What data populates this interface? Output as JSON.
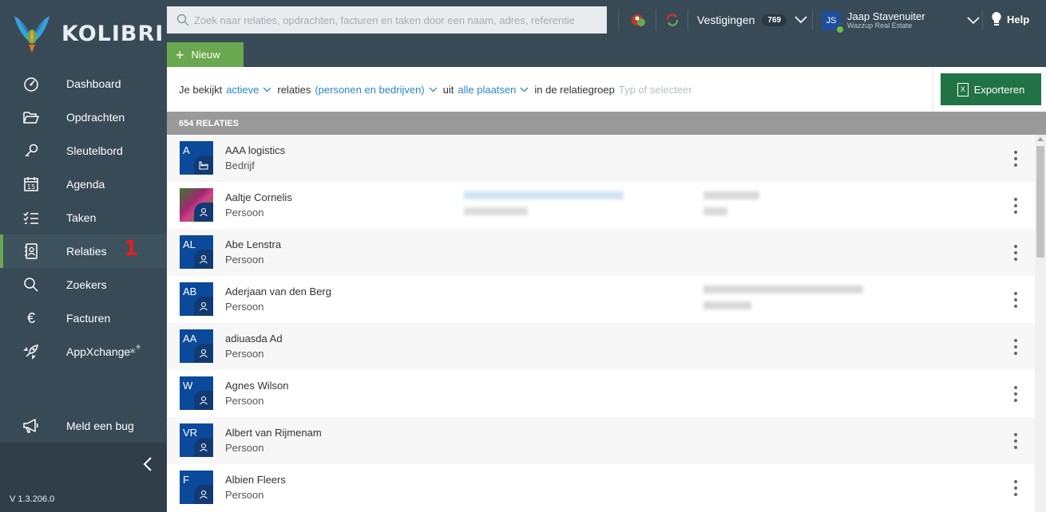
{
  "app": {
    "logo_text": "KOLIBRI",
    "version": "V 1.3.206.0"
  },
  "sidebar": {
    "items": [
      {
        "label": "Dashboard",
        "icon": "speedometer-icon"
      },
      {
        "label": "Opdrachten",
        "icon": "folder-open-icon"
      },
      {
        "label": "Sleutelbord",
        "icon": "key-icon"
      },
      {
        "label": "Agenda",
        "icon": "calendar-icon",
        "icon_text": "15"
      },
      {
        "label": "Taken",
        "icon": "checklist-icon"
      },
      {
        "label": "Relaties",
        "icon": "contact-card-icon",
        "active": true,
        "annotation": "1"
      },
      {
        "label": "Zoekers",
        "icon": "search-icon"
      },
      {
        "label": "Facturen",
        "icon": "euro-icon",
        "icon_text": "€"
      },
      {
        "label": "AppXchange",
        "icon": "rocket-icon"
      }
    ],
    "bug": {
      "label": "Meld een bug",
      "icon": "megaphone-icon"
    }
  },
  "topbar": {
    "search_placeholder": "Zoek naar relaties, opdrachten, facturen en taken door een naam, adres, referentie",
    "vestigingen": {
      "label": "Vestigingen",
      "count": "769"
    },
    "user": {
      "initials": "JS",
      "name": "Jaap Stavenuiter",
      "org": "Wazzup Real Estate"
    },
    "help_label": "Help",
    "new_label": "Nieuw"
  },
  "filter": {
    "prefix": "Je bekijkt",
    "status": "actieve",
    "relaties_word": "relaties",
    "type": "(personen en bedrijven)",
    "uit_word": "uit",
    "place": "alle plaatsen",
    "group_text": "in de relatiegroep",
    "group_placeholder": "Typ of selecteer",
    "export_label": "Exporteren"
  },
  "list": {
    "count_label": "654 RELATIES",
    "rows": [
      {
        "initials": "A",
        "name": "AAA logistics",
        "type": "Bedrijf",
        "kind": "company"
      },
      {
        "initials": "",
        "name": "Aaltje Cornelis",
        "type": "Persoon",
        "kind": "person",
        "photo": true
      },
      {
        "initials": "AL",
        "name": "Abe Lenstra",
        "type": "Persoon",
        "kind": "person"
      },
      {
        "initials": "AB",
        "name": "Aderjaan van den Berg",
        "type": "Persoon",
        "kind": "person"
      },
      {
        "initials": "AA",
        "name": "adiuasda Ad",
        "type": "Persoon",
        "kind": "person"
      },
      {
        "initials": "W",
        "name": "Agnes Wilson",
        "type": "Persoon",
        "kind": "person"
      },
      {
        "initials": "VR",
        "name": "Albert van Rijmenam",
        "type": "Persoon",
        "kind": "person"
      },
      {
        "initials": "F",
        "name": "Albien Fleers",
        "type": "Persoon",
        "kind": "person"
      }
    ]
  },
  "colors": {
    "sidebar": "#384a55",
    "accent_green": "#6aa84f",
    "excel_green": "#217346",
    "link_blue": "#2e86c1",
    "tile_blue": "#0b4a9a"
  }
}
